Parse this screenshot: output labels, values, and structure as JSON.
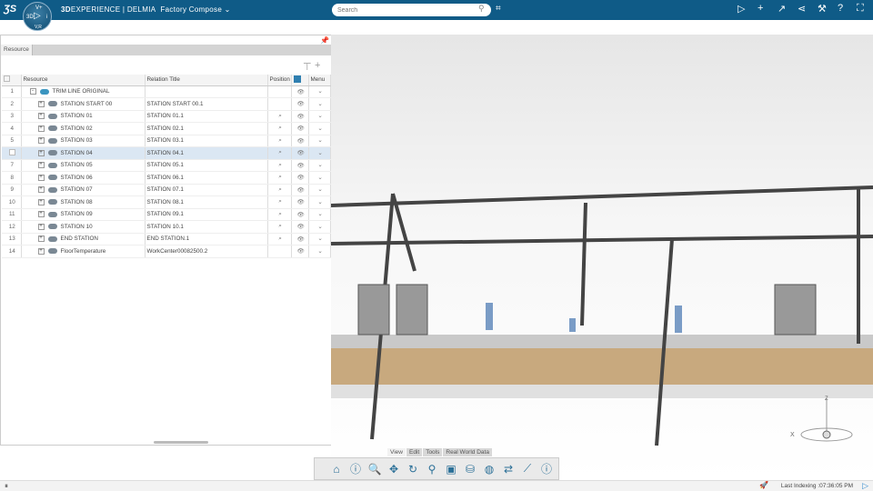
{
  "header": {
    "brand_bold": "3D",
    "brand_rest": "EXPERIENCE | DELMIA",
    "app": "Factory Compose",
    "compass": {
      "top": "V+",
      "left": "3D",
      "right": "i",
      "bottom": "V,R"
    },
    "search_placeholder": "Search"
  },
  "panel": {
    "tab": "Resource",
    "columns": [
      "Resource",
      "Relation Title",
      "Position",
      "",
      "Menu"
    ],
    "rows": [
      {
        "n": "1",
        "resource": "TRIM LINE ORIGINAL",
        "relation": "",
        "expand": "-"
      },
      {
        "n": "2",
        "resource": "STATION START 00",
        "relation": "STATION START 00.1",
        "expand": "+"
      },
      {
        "n": "3",
        "resource": "STATION 01",
        "relation": "STATION 01.1",
        "expand": "+"
      },
      {
        "n": "4",
        "resource": "STATION 02",
        "relation": "STATION 02.1",
        "expand": "+"
      },
      {
        "n": "5",
        "resource": "STATION 03",
        "relation": "STATION 03.1",
        "expand": "+"
      },
      {
        "n": "",
        "resource": "STATION 04",
        "relation": "STATION 04.1",
        "expand": "+",
        "selected": true
      },
      {
        "n": "7",
        "resource": "STATION 05",
        "relation": "STATION 05.1",
        "expand": "+"
      },
      {
        "n": "8",
        "resource": "STATION 06",
        "relation": "STATION 06.1",
        "expand": "+"
      },
      {
        "n": "9",
        "resource": "STATION 07",
        "relation": "STATION 07.1",
        "expand": "+"
      },
      {
        "n": "10",
        "resource": "STATION 08",
        "relation": "STATION 08.1",
        "expand": "+"
      },
      {
        "n": "11",
        "resource": "STATION 09",
        "relation": "STATION 09.1",
        "expand": "+"
      },
      {
        "n": "12",
        "resource": "STATION 10",
        "relation": "STATION 10.1",
        "expand": "+"
      },
      {
        "n": "13",
        "resource": "END STATION",
        "relation": "END STATION.1",
        "expand": "+"
      },
      {
        "n": "14",
        "resource": "FloorTemperature",
        "relation": "WorkCenter00082500.2",
        "expand": "+"
      }
    ]
  },
  "viewer": {
    "tabs": [
      "View",
      "Edit",
      "Tools",
      "Real World Data"
    ],
    "active_tab": "View",
    "compass_axes": [
      "X",
      "Z"
    ],
    "actions": [
      "home-icon",
      "alert-icon",
      "zoom-icon",
      "pan-icon",
      "rotate-icon",
      "zoom-area-icon",
      "box-icon",
      "database-icon",
      "globe-icon",
      "swap-icon",
      "measure-icon",
      "info-icon"
    ]
  },
  "status": {
    "indexing": "Last Indexing :07:36:05 PM"
  }
}
